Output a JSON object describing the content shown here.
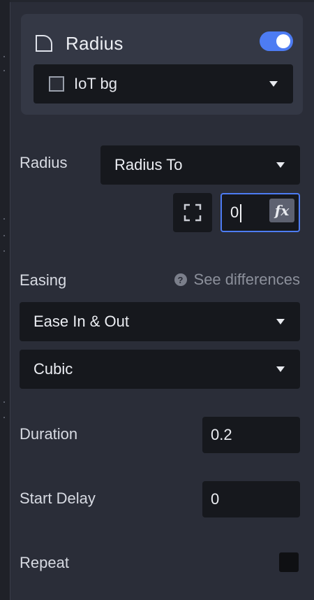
{
  "card": {
    "title": "Radius",
    "toggle_on": true,
    "layer": {
      "label": "IoT bg",
      "icon": "square-swatch-icon"
    }
  },
  "radius": {
    "label": "Radius",
    "mode": "Radius To",
    "value": "0",
    "fx_label": "fx",
    "expand_icon": "expand-corners-icon"
  },
  "easing": {
    "label": "Easing",
    "help_link": "See differences",
    "help_icon": "question-circle-icon",
    "type": "Ease In & Out",
    "curve": "Cubic"
  },
  "duration": {
    "label": "Duration",
    "value": "0.2"
  },
  "start_delay": {
    "label": "Start Delay",
    "value": "0"
  },
  "repeat": {
    "label": "Repeat",
    "checked": false
  },
  "colors": {
    "panel_bg": "#2a2d38",
    "card_bg": "#343845",
    "field_bg": "#16181d",
    "accent": "#4d7cf3"
  }
}
